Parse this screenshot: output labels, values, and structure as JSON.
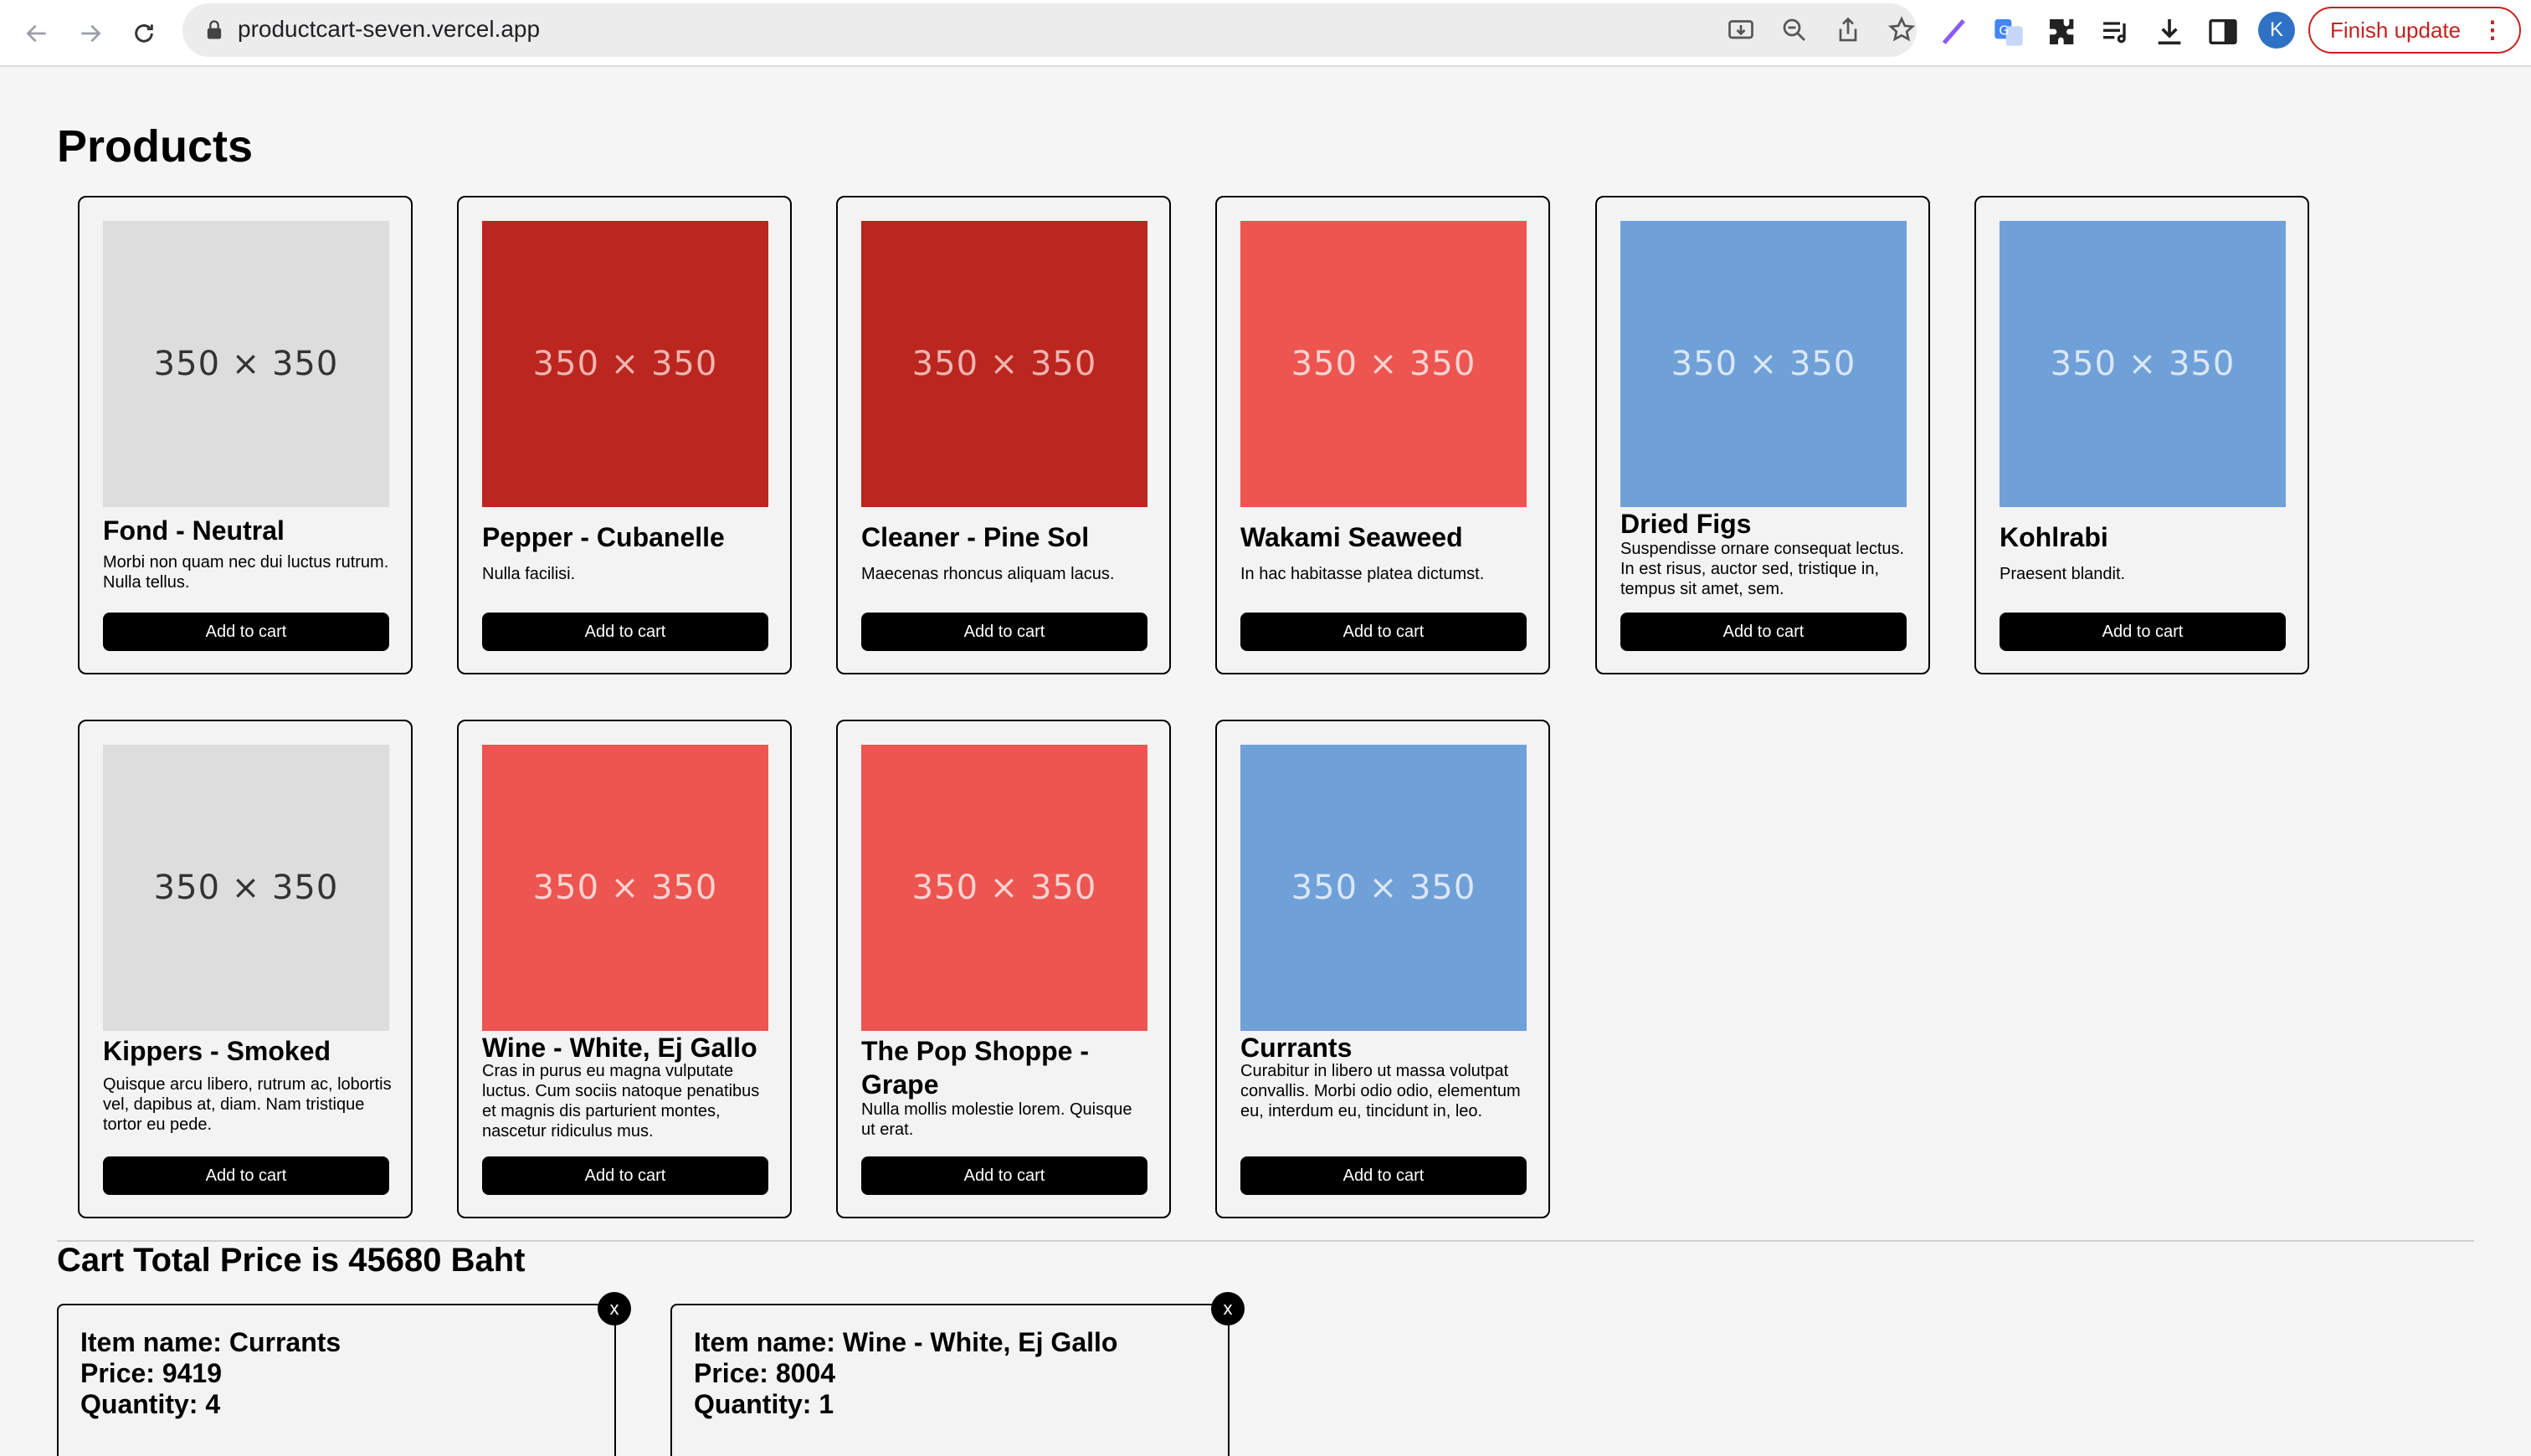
{
  "browser": {
    "url": "productcart-seven.vercel.app",
    "update_label": "Finish update",
    "avatar_initial": "K"
  },
  "page": {
    "title": "Products"
  },
  "products": [
    {
      "name": "Fond - Neutral",
      "desc": "Morbi non quam nec dui luctus rutrum. Nulla tellus.",
      "image_text": "350 × 350",
      "color": "#dddddd",
      "button": "Add to cart"
    },
    {
      "name": "Pepper - Cubanelle",
      "desc": "Nulla facilisi.",
      "image_text": "350 × 350",
      "color": "#bb261e",
      "button": "Add to cart"
    },
    {
      "name": "Cleaner - Pine Sol",
      "desc": "Maecenas rhoncus aliquam lacus.",
      "image_text": "350 × 350",
      "color": "#bb261e",
      "button": "Add to cart"
    },
    {
      "name": "Wakami Seaweed",
      "desc": "In hac habitasse platea dictumst.",
      "image_text": "350 × 350",
      "color": "#ec5550",
      "button": "Add to cart"
    },
    {
      "name": "Dried Figs",
      "desc": "Suspendisse ornare consequat lectus. In est risus, auctor sed, tristique in, tempus sit amet, sem.",
      "image_text": "350 × 350",
      "color": "#6fa0d8",
      "button": "Add to cart"
    },
    {
      "name": "Kohlrabi",
      "desc": "Praesent blandit.",
      "image_text": "350 × 350",
      "color": "#6fa0d8",
      "button": "Add to cart"
    },
    {
      "name": "Kippers - Smoked",
      "desc": "Quisque arcu libero, rutrum ac, lobortis vel, dapibus at, diam. Nam tristique tortor eu pede.",
      "image_text": "350 × 350",
      "color": "#dddddd",
      "button": "Add to cart"
    },
    {
      "name": "Wine - White, Ej Gallo",
      "desc": "Cras in purus eu magna vulputate luctus. Cum sociis natoque penatibus et magnis dis parturient montes, nascetur ridiculus mus.",
      "image_text": "350 × 350",
      "color": "#ec5550",
      "button": "Add to cart"
    },
    {
      "name": "The Pop Shoppe - Grape",
      "desc": "Nulla mollis molestie lorem. Quisque ut erat.",
      "image_text": "350 × 350",
      "color": "#ec5550",
      "button": "Add to cart"
    },
    {
      "name": "Currants",
      "desc": "Curabitur in libero ut massa volutpat convallis. Morbi odio odio, elementum eu, interdum eu, tincidunt in, leo.",
      "image_text": "350 × 350",
      "color": "#6fa0d8",
      "button": "Add to cart"
    }
  ],
  "cart": {
    "total_text": "Cart Total Price is 45680 Baht",
    "items": [
      {
        "name_line": "Item name: Currants",
        "price_line": "Price: 9419",
        "qty_line": "Quantity: 4",
        "remove": "x"
      },
      {
        "name_line": "Item name: Wine - White, Ej Gallo",
        "price_line": "Price: 8004",
        "qty_line": "Quantity: 1",
        "remove": "x"
      }
    ]
  }
}
